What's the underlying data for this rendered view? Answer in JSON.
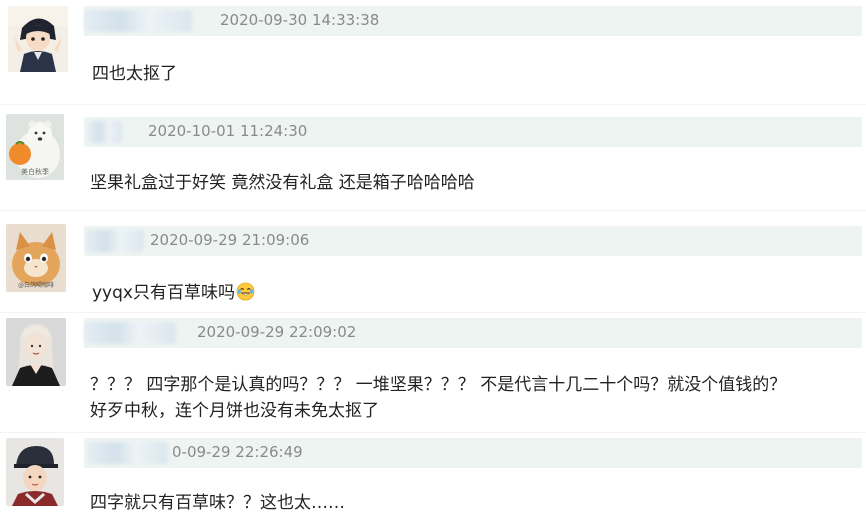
{
  "comments": [
    {
      "username_visible": false,
      "timestamp": "2020-09-30 14:33:38",
      "lines": [
        "四也太抠了"
      ]
    },
    {
      "username_visible": false,
      "timestamp": "2020-10-01 11:24:30",
      "avatar_caption": "美白秋季",
      "lines": [
        "坚果礼盒过于好笑 竟然没有礼盒 还是箱子哈哈哈哈"
      ]
    },
    {
      "username_visible": false,
      "timestamp": "2020-09-29 21:09:06",
      "avatar_caption": "@白鸽喝咖啡",
      "lines": [
        "yyqx只有百草味吗"
      ],
      "emoji": "laughing-tears-emoji"
    },
    {
      "username_visible": false,
      "timestamp": "2020-09-29 22:09:02",
      "lines": [
        "？？？ 四字那个是认真的吗？？？ 一堆坚果？？？ 不是代言十几二十个吗？就没个值钱的？",
        "好歹中秋，连个月饼也没有未免太抠了"
      ]
    },
    {
      "username_visible": false,
      "timestamp": "0-09-29 22:26:49",
      "lines": [
        "四字就只有百草味？？这也太……"
      ]
    }
  ],
  "colors": {
    "header_bar": "#eef4f2",
    "timestamp": "#8a8a8a",
    "text": "#222222"
  }
}
